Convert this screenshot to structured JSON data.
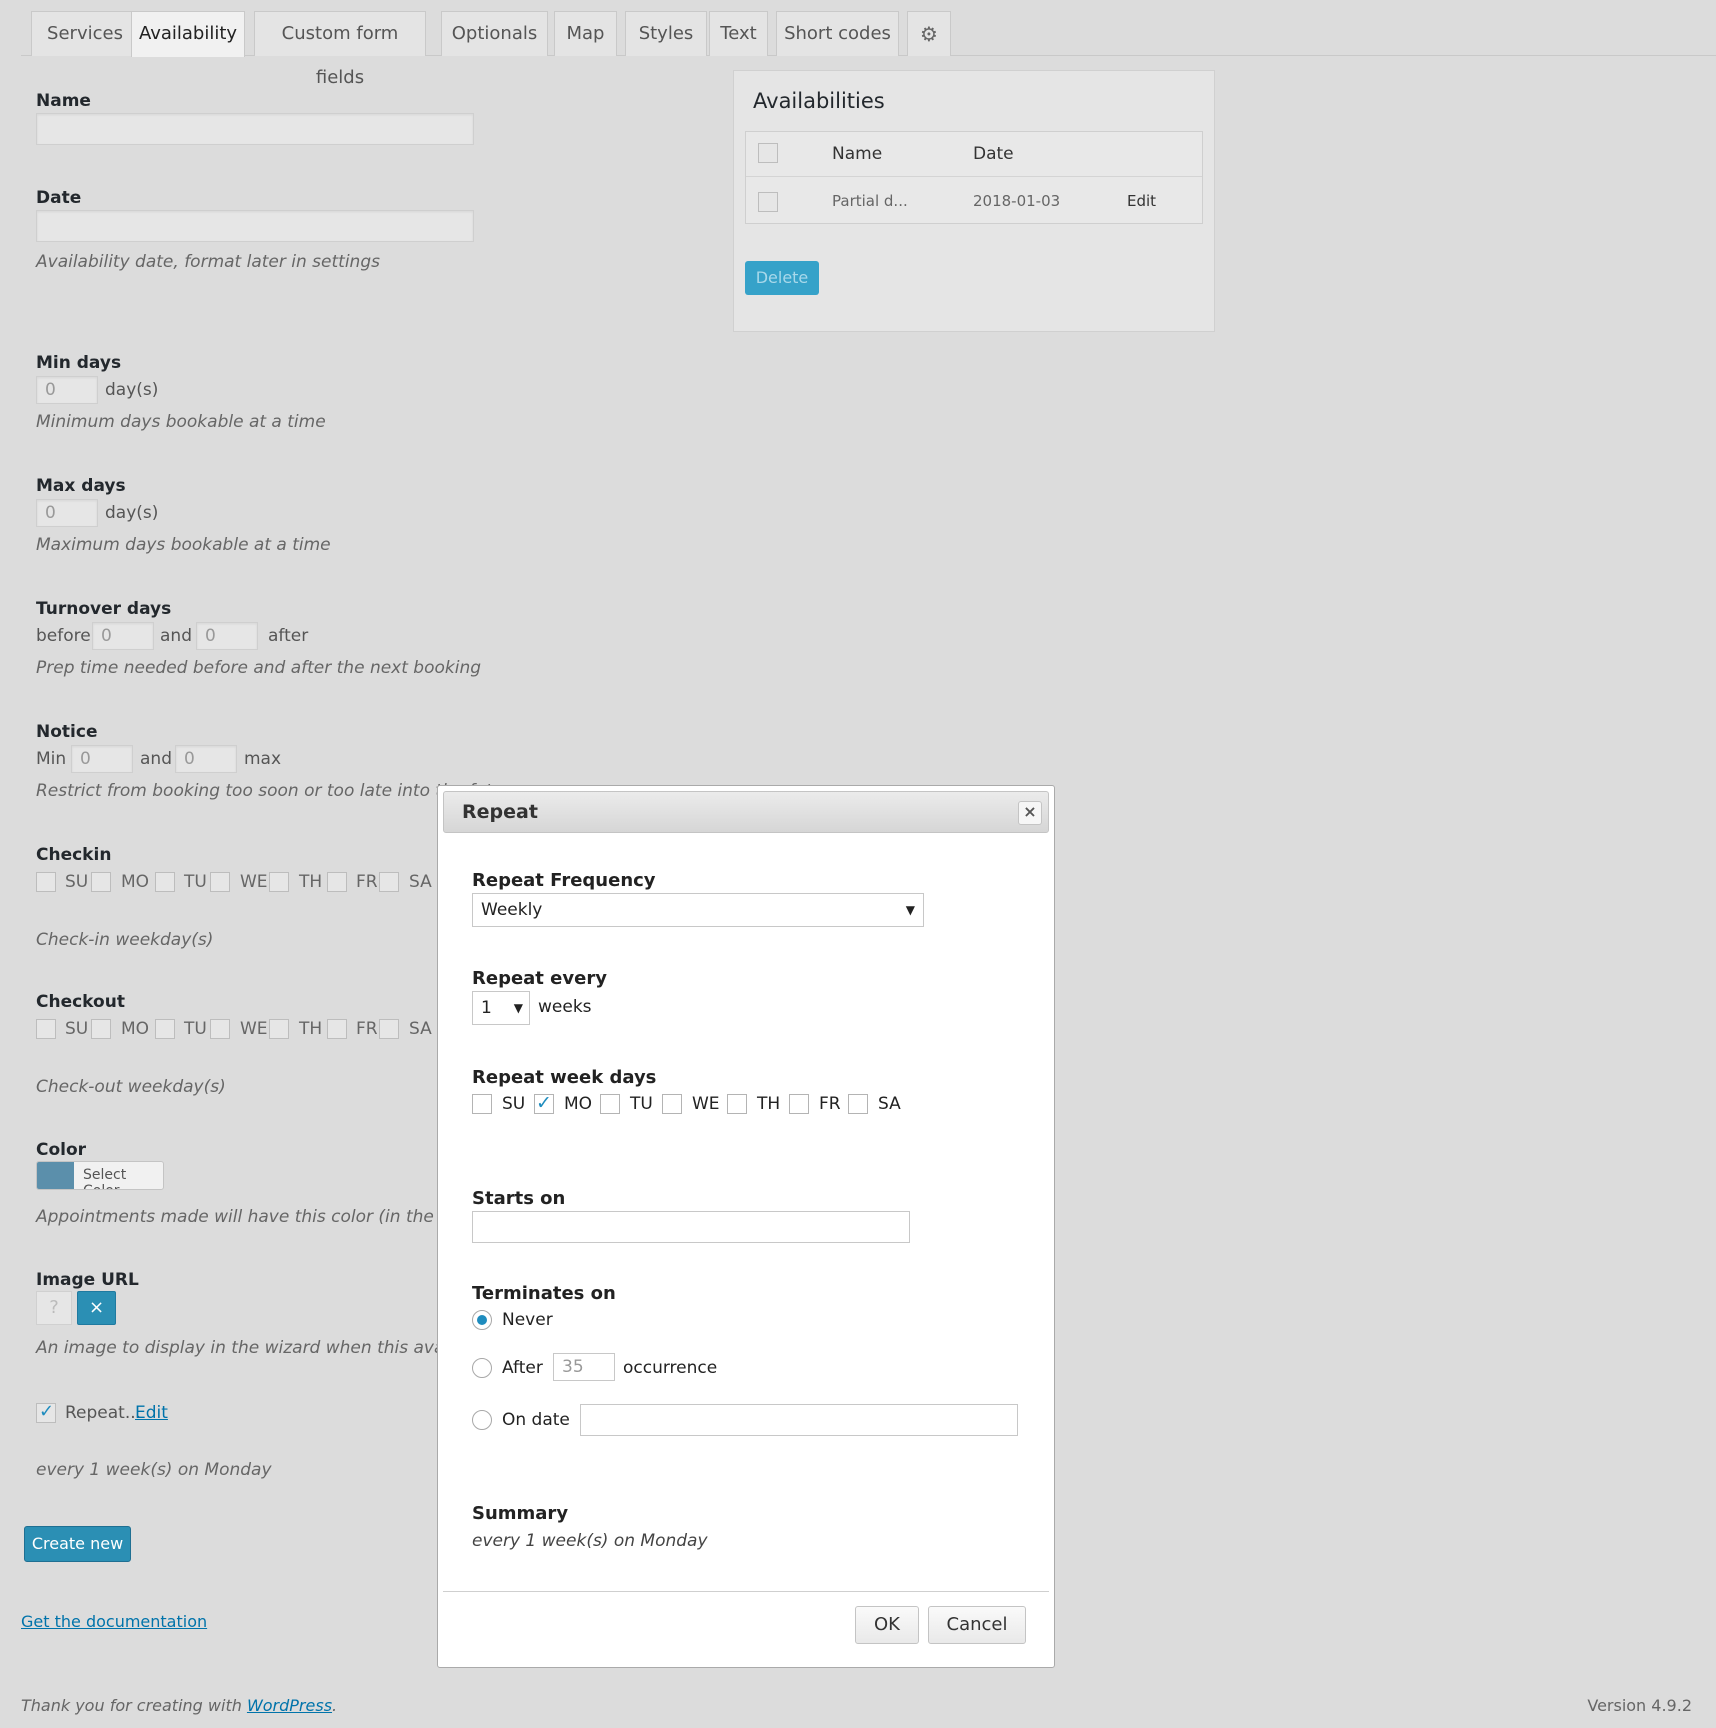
{
  "tabs": [
    {
      "label": "Services"
    },
    {
      "label": "Availability"
    },
    {
      "label": "Custom form fields"
    },
    {
      "label": "Optionals"
    },
    {
      "label": "Map"
    },
    {
      "label": "Styles"
    },
    {
      "label": "Text"
    },
    {
      "label": "Short codes"
    }
  ],
  "form": {
    "name_label": "Name",
    "name_value": "",
    "date_label": "Date",
    "date_value": "",
    "date_desc": "Availability date, format later in settings",
    "min_days_label": "Min days",
    "min_days_value": "0",
    "min_days_unit": "day(s)",
    "min_days_desc": "Minimum days bookable at a time",
    "max_days_label": "Max days",
    "max_days_value": "0",
    "max_days_unit": "day(s)",
    "max_days_desc": "Maximum days bookable at a time",
    "turnover_label": "Turnover days",
    "turnover_before": "before",
    "turnover_before_value": "0",
    "turnover_and": "and",
    "turnover_after_value": "0",
    "turnover_after": "after",
    "turnover_desc": "Prep time needed before and after the next booking",
    "notice_label": "Notice",
    "notice_min": "Min",
    "notice_min_value": "0",
    "notice_and": "and",
    "notice_max_value": "0",
    "notice_max": "max",
    "notice_desc": "Restrict from booking too soon or too late into the fut",
    "checkin_label": "Checkin",
    "checkin_desc": "Check-in weekday(s)",
    "checkout_label": "Checkout",
    "checkout_desc": "Check-out weekday(s)",
    "weekdays": [
      "SU",
      "MO",
      "TU",
      "WE",
      "TH",
      "FR",
      "SA"
    ],
    "color_label": "Color",
    "color_button": "Select Color",
    "color_swatch": "#5b8fab",
    "color_desc": "Appointments made will have this color (in the appoi",
    "image_label": "Image URL",
    "image_placeholder_icon": "?",
    "image_remove_icon": "×",
    "image_desc": "An image to display in the wizard when this availabili",
    "repeat_label": "Repeat...",
    "repeat_edit": "Edit",
    "repeat_summary": "every 1 week(s) on Monday",
    "create_button": "Create new",
    "doc_link": "Get the documentation"
  },
  "availabilities": {
    "title": "Availabilities",
    "col_name": "Name",
    "col_date": "Date",
    "rows": [
      {
        "name": "Partial d...",
        "date": "2018-01-03",
        "action": "Edit"
      }
    ],
    "delete_button": "Delete"
  },
  "dialog": {
    "title": "Repeat",
    "close_icon": "×",
    "frequency_label": "Repeat Frequency",
    "frequency_value": "Weekly",
    "every_label": "Repeat every",
    "every_value": "1",
    "every_unit": "weeks",
    "weekdays_label": "Repeat week days",
    "weekdays": [
      "SU",
      "MO",
      "TU",
      "WE",
      "TH",
      "FR",
      "SA"
    ],
    "weekdays_checked": [
      false,
      true,
      false,
      false,
      false,
      false,
      false
    ],
    "starts_label": "Starts on",
    "starts_value": "",
    "terminates_label": "Terminates on",
    "never_label": "Never",
    "after_label": "After",
    "after_value": "35",
    "occurrence_label": "occurrence",
    "ondate_label": "On date",
    "ondate_value": "",
    "summary_label": "Summary",
    "summary_text": "every 1 week(s) on Monday",
    "ok_button": "OK",
    "cancel_button": "Cancel"
  },
  "footer": {
    "thanks_prefix": "Thank you for creating with ",
    "wordpress_link": "WordPress",
    "thanks_suffix": ".",
    "version": "Version 4.9.2"
  },
  "colors": {
    "accent": "#1e8cbe",
    "primary_button": "#2b8fb4",
    "delete_button": "#36a2c9"
  }
}
